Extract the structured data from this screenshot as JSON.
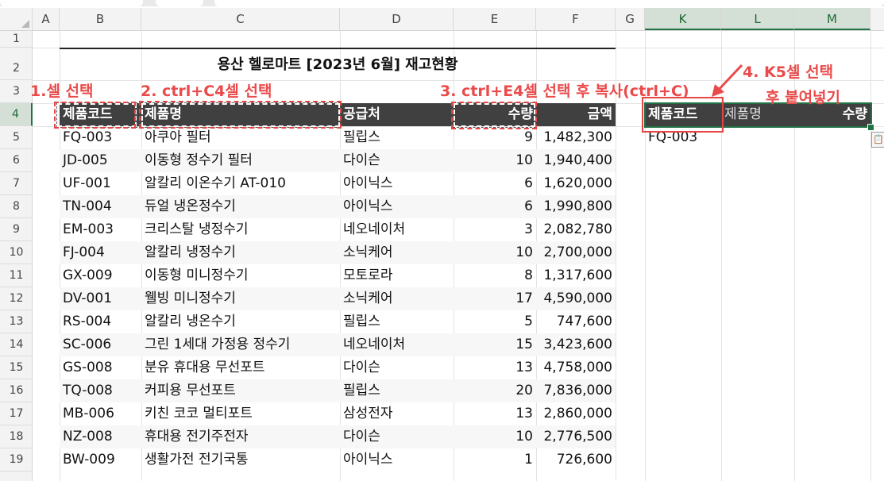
{
  "columns": [
    "A",
    "B",
    "C",
    "D",
    "E",
    "F",
    "G",
    "K",
    "L",
    "M"
  ],
  "rows": [
    "1",
    "2",
    "3",
    "4",
    "5",
    "6",
    "7",
    "8",
    "9",
    "10",
    "11",
    "12",
    "13",
    "14",
    "15",
    "16",
    "17",
    "18",
    "19"
  ],
  "title": "용산 헬로마트 [2023년 6월] 재고현황",
  "headers": {
    "code": "제품코드",
    "name": "제품명",
    "supplier": "공급처",
    "qty": "수량",
    "amount": "금액"
  },
  "table": [
    {
      "code": "FQ-003",
      "name": "아쿠아 필터",
      "supplier": "필립스",
      "qty": "9",
      "amount": "1,482,300"
    },
    {
      "code": "JD-005",
      "name": "이동형 정수기 필터",
      "supplier": "다이슨",
      "qty": "10",
      "amount": "1,940,400"
    },
    {
      "code": "UF-001",
      "name": "알칼리 이온수기 AT-010",
      "supplier": "아이닉스",
      "qty": "6",
      "amount": "1,620,000"
    },
    {
      "code": "TN-004",
      "name": "듀얼 냉온정수기",
      "supplier": "아이닉스",
      "qty": "6",
      "amount": "1,990,800"
    },
    {
      "code": "EM-003",
      "name": "크리스탈 냉정수기",
      "supplier": "네오네이처",
      "qty": "3",
      "amount": "2,082,780"
    },
    {
      "code": "FJ-004",
      "name": "알칼리 냉정수기",
      "supplier": "소닉케어",
      "qty": "10",
      "amount": "2,700,000"
    },
    {
      "code": "GX-009",
      "name": "이동형 미니정수기",
      "supplier": "모토로라",
      "qty": "8",
      "amount": "1,317,600"
    },
    {
      "code": "DV-001",
      "name": "웰빙 미니정수기",
      "supplier": "소닉케어",
      "qty": "17",
      "amount": "4,590,000"
    },
    {
      "code": "RS-004",
      "name": "알칼리 냉온수기",
      "supplier": "필립스",
      "qty": "5",
      "amount": "747,600"
    },
    {
      "code": "SC-006",
      "name": "그린 1세대 가정용 정수기",
      "supplier": "네오네이처",
      "qty": "15",
      "amount": "3,423,600"
    },
    {
      "code": "GS-008",
      "name": "분유 휴대용 무선포트",
      "supplier": "다이슨",
      "qty": "13",
      "amount": "4,758,000"
    },
    {
      "code": "TQ-008",
      "name": "커피용 무선포트",
      "supplier": "필립스",
      "qty": "20",
      "amount": "7,836,000"
    },
    {
      "code": "MB-006",
      "name": "키친 코코 멀티포트",
      "supplier": "삼성전자",
      "qty": "13",
      "amount": "2,860,000"
    },
    {
      "code": "NZ-008",
      "name": "휴대용 전기주전자",
      "supplier": "다이슨",
      "qty": "10",
      "amount": "2,776,500"
    },
    {
      "code": "BW-009",
      "name": "생활가전 전기국통",
      "supplier": "아이닉스",
      "qty": "1",
      "amount": "726,600"
    }
  ],
  "pasted": {
    "code": "제품코드",
    "name": "제품명",
    "qty": "수량",
    "first_value": "FQ-003"
  },
  "annotations": {
    "step1": "1.셀 선택",
    "step2": "2. ctrl+C4셀 선택",
    "step3": "3. ctrl+E4셀 선택 후 복사(ctrl+C)",
    "step4a": "4. K5셀 선택",
    "step4b": "후 붙여넣기"
  },
  "colors": {
    "header_bg": "#404040",
    "annotation": "#ea4a4a",
    "selection": "#217346"
  }
}
